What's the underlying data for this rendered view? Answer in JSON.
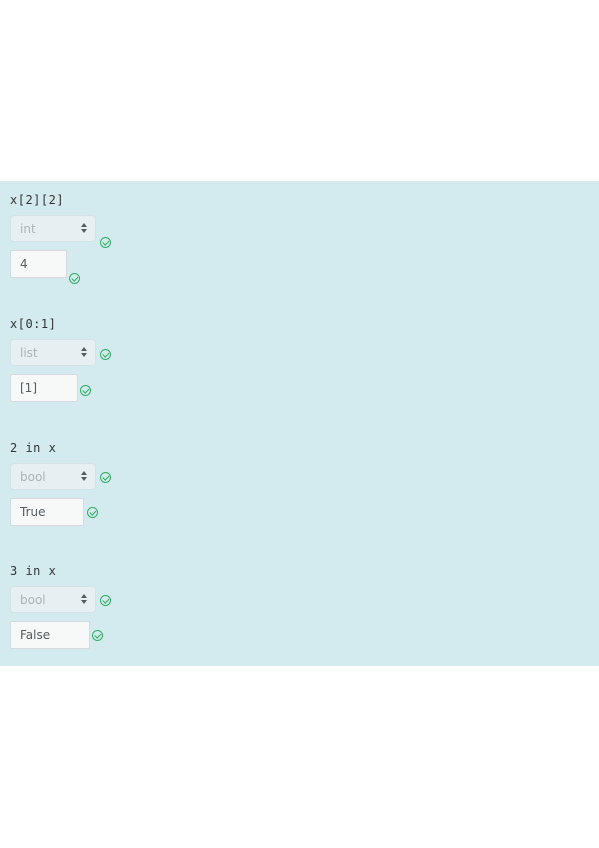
{
  "questions": [
    {
      "expression": "x[2][2]",
      "type_value": "int",
      "answer_value": "4"
    },
    {
      "expression": "x[0:1]",
      "type_value": "list",
      "answer_value": "[1]"
    },
    {
      "expression": "2 in x",
      "type_value": "bool",
      "answer_value": "True"
    },
    {
      "expression": "3 in x",
      "type_value": "bool",
      "answer_value": "False"
    }
  ],
  "colors": {
    "panel_background": "#d3eaef",
    "correct_icon": "#2fae5f"
  },
  "icons": {
    "select_caret": "caret-up-down-icon",
    "correct_mark": "check-circle-icon"
  }
}
